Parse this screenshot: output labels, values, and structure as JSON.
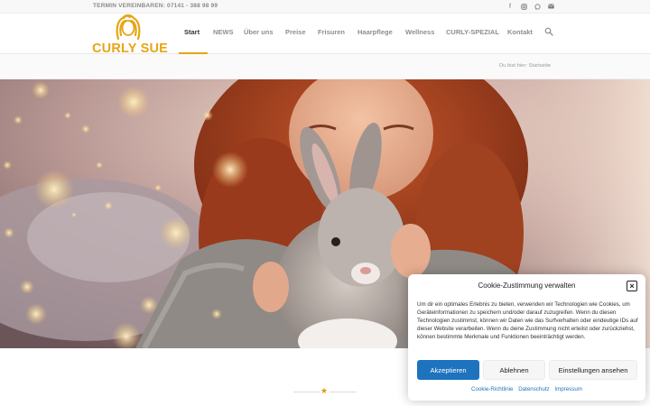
{
  "topbar": {
    "phone": "TERMIN VEREINBAREN: 07141 - 388 98 99",
    "social_icons": [
      "facebook-icon",
      "instagram-icon",
      "whatsapp-icon",
      "mail-icon"
    ]
  },
  "header": {
    "logo_text": "CURLY SUE",
    "nav": [
      "Start",
      "NEWS",
      "Über uns",
      "Preise",
      "Frisuren",
      "Haarpflege",
      "Wellness",
      "CURLY-SPEZIAL",
      "Kontakt"
    ],
    "active_nav": "Start",
    "accent_color": "#e7a515"
  },
  "breadcrumb": {
    "text": "Du bist hier: Startseite"
  },
  "hero": {
    "image": "woman-with-rabbit-photo"
  },
  "divider": {
    "icon": "star-icon"
  },
  "cookie": {
    "title": "Cookie-Zustimmung verwalten",
    "text": "Um dir ein optimales Erlebnis zu bieten, verwenden wir Technologien wie Cookies, um Geräteinformationen zu speichern und/oder darauf zuzugreifen. Wenn du diesen Technologien zustimmst, können wir Daten wie das Surfverhalten oder eindeutige IDs auf dieser Website verarbeiten. Wenn du deine Zustimmung nicht erteilst oder zurückziehst, können bestimmte Merkmale und Funktionen beeinträchtigt werden.",
    "accept": "Akzeptieren",
    "deny": "Ablehnen",
    "settings": "Einstellungen ansehen",
    "links": [
      "Cookie-Richtlinie",
      "Datenschutz",
      "Impressum"
    ],
    "button_color": "#1e73be"
  }
}
